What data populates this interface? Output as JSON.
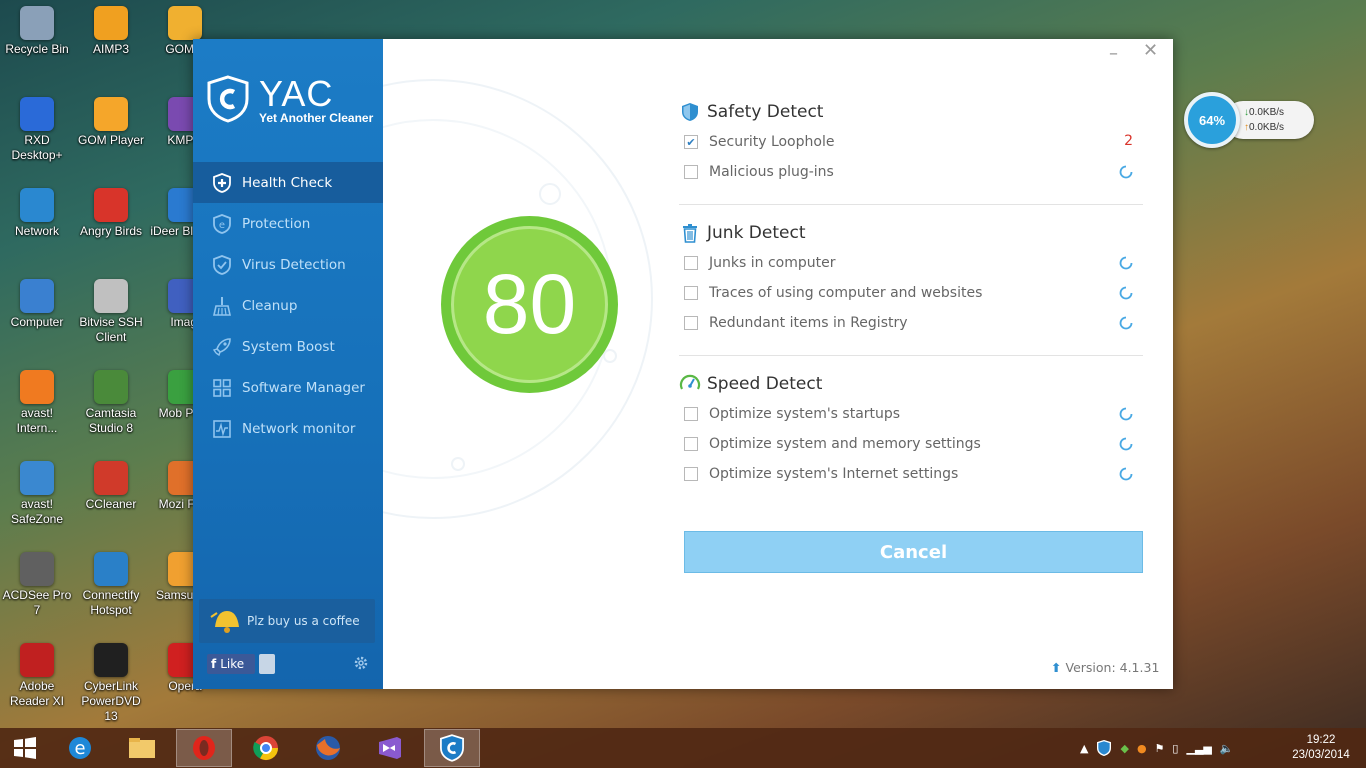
{
  "desktop": {
    "icons": [
      {
        "label": "Recycle Bin",
        "color": "#8aa0b8"
      },
      {
        "label": "AIMP3",
        "color": "#f0a020"
      },
      {
        "label": "GOM A",
        "color": "#f0b030"
      },
      {
        "label": "RXD Desktop+",
        "color": "#2a6ad8"
      },
      {
        "label": "GOM Player",
        "color": "#f5a62a"
      },
      {
        "label": "KMPla",
        "color": "#7a4ab0"
      },
      {
        "label": "Network",
        "color": "#2a88d0"
      },
      {
        "label": "Angry Birds",
        "color": "#d8342a"
      },
      {
        "label": "iDeer Bl Play",
        "color": "#2a7ad0"
      },
      {
        "label": "Computer",
        "color": "#3a80d0"
      },
      {
        "label": "Bitvise SSH Client",
        "color": "#c0c0c0"
      },
      {
        "label": "Imagi",
        "color": "#4060c0"
      },
      {
        "label": "avast! Intern...",
        "color": "#f07a20"
      },
      {
        "label": "Camtasia Studio 8",
        "color": "#4a8a3a"
      },
      {
        "label": "Mob Partr",
        "color": "#3aa040"
      },
      {
        "label": "avast! SafeZone",
        "color": "#3a88d0"
      },
      {
        "label": "CCleaner",
        "color": "#d03a2a"
      },
      {
        "label": "Mozi Firef",
        "color": "#e0702a"
      },
      {
        "label": "ACDSee Pro 7",
        "color": "#606060"
      },
      {
        "label": "Connectify Hotspot",
        "color": "#2a80c8"
      },
      {
        "label": "Samsu Kie",
        "color": "#f0a030"
      },
      {
        "label": "Adobe Reader XI",
        "color": "#c02020"
      },
      {
        "label": "CyberLink PowerDVD 13",
        "color": "#202020"
      },
      {
        "label": "Opera",
        "color": "#d02020"
      }
    ]
  },
  "net_widget": {
    "percent": "64%",
    "down": "0.0KB/s",
    "up": "0.0KB/s"
  },
  "app": {
    "logo_title": "YAC",
    "logo_subtitle": "Yet Another Cleaner",
    "nav": [
      {
        "label": "Health Check",
        "icon": "plus-shield-icon",
        "active": true
      },
      {
        "label": "Protection",
        "icon": "e-shield-icon"
      },
      {
        "label": "Virus Detection",
        "icon": "check-shield-icon"
      },
      {
        "label": "Cleanup",
        "icon": "broom-icon"
      },
      {
        "label": "System Boost",
        "icon": "rocket-icon"
      },
      {
        "label": "Software Manager",
        "icon": "grid-icon"
      },
      {
        "label": "Network monitor",
        "icon": "monitor-chart-icon"
      }
    ],
    "coffee_label": "Plz buy us a coffee",
    "like_label": "Like",
    "score": "80",
    "sections": [
      {
        "title": "Safety Detect",
        "items": [
          {
            "label": "Security Loophole",
            "checked": true,
            "status": "2"
          },
          {
            "label": "Malicious plug-ins",
            "checked": false,
            "status": "loading"
          }
        ]
      },
      {
        "title": "Junk Detect",
        "items": [
          {
            "label": "Junks in computer",
            "checked": false,
            "status": "loading"
          },
          {
            "label": "Traces of using computer and websites",
            "checked": false,
            "status": "loading"
          },
          {
            "label": "Redundant items in Registry",
            "checked": false,
            "status": "loading"
          }
        ]
      },
      {
        "title": "Speed Detect",
        "items": [
          {
            "label": "Optimize system's startups",
            "checked": false,
            "status": "loading"
          },
          {
            "label": "Optimize system and memory settings",
            "checked": false,
            "status": "loading"
          },
          {
            "label": "Optimize system's Internet settings",
            "checked": false,
            "status": "loading"
          }
        ]
      }
    ],
    "cancel_label": "Cancel",
    "version_label": "Version: 4.1.31",
    "accent": "#1c7cc6",
    "score_color": "#8fd64c"
  },
  "taskbar": {
    "items": [
      "windows-start-icon",
      "internet-explorer-icon",
      "file-explorer-icon",
      "opera-icon",
      "chrome-icon",
      "firefox-icon",
      "visual-studio-icon",
      "yac-icon"
    ],
    "time": "19:22",
    "date": "23/03/2014"
  }
}
